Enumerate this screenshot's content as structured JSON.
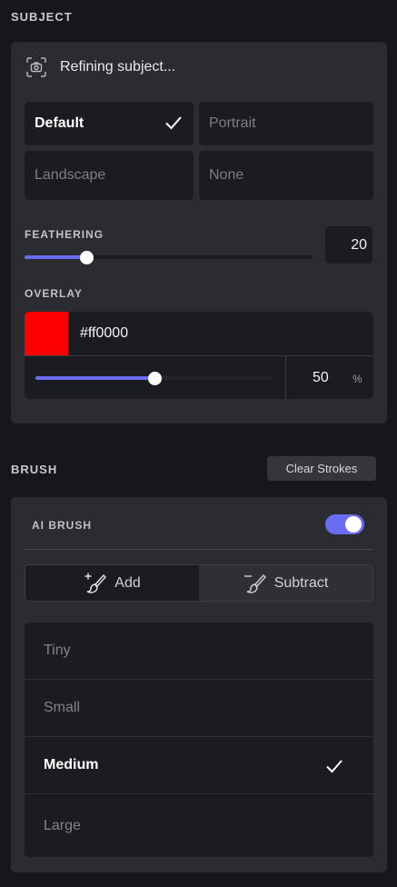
{
  "subject": {
    "title": "SUBJECT",
    "status_text": "Refining subject...",
    "presets": [
      {
        "label": "Default",
        "selected": true
      },
      {
        "label": "Portrait",
        "selected": false
      },
      {
        "label": "Landscape",
        "selected": false
      },
      {
        "label": "None",
        "selected": false
      }
    ],
    "feathering": {
      "label": "FEATHERING",
      "value": "20",
      "fraction": 0.2
    },
    "overlay": {
      "label": "OVERLAY",
      "color_hex": "#ff0000",
      "opacity_value": "50",
      "opacity_unit": "%",
      "fraction": 0.5
    }
  },
  "brush": {
    "title": "BRUSH",
    "clear_label": "Clear Strokes",
    "ai_brush_label": "AI BRUSH",
    "ai_brush_on": true,
    "modes": [
      {
        "label": "Add",
        "icon": "brush-add-icon",
        "selected": true
      },
      {
        "label": "Subtract",
        "icon": "brush-subtract-icon",
        "selected": false
      }
    ],
    "sizes": [
      {
        "label": "Tiny",
        "selected": false
      },
      {
        "label": "Small",
        "selected": false
      },
      {
        "label": "Medium",
        "selected": true
      },
      {
        "label": "Large",
        "selected": false
      }
    ]
  },
  "colors": {
    "accent": "#6a6cf2",
    "overlay": "#ff0000",
    "panel": "#2b2c31",
    "background": "#16171c"
  }
}
